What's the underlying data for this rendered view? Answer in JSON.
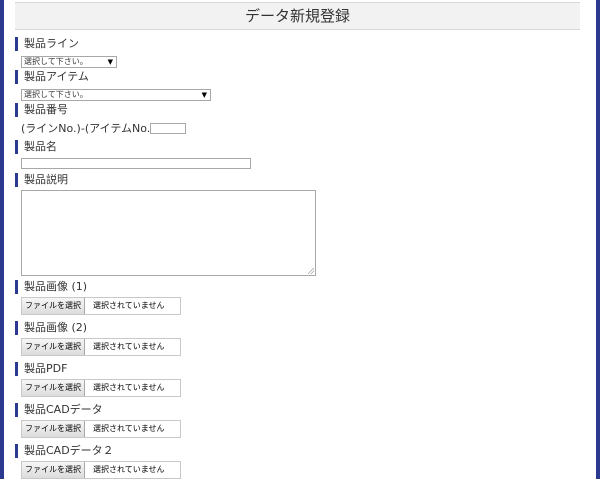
{
  "page": {
    "title": "データ新規登録"
  },
  "form": {
    "product_line": {
      "label": "製品ライン",
      "selected": "選択して下さい。"
    },
    "product_item": {
      "label": "製品アイテム",
      "selected": "選択して下さい。"
    },
    "product_number": {
      "label": "製品番号",
      "prefix": "(ラインNo.)-(アイテムNo.)-",
      "value": ""
    },
    "product_name": {
      "label": "製品名",
      "value": ""
    },
    "product_description": {
      "label": "製品説明",
      "value": ""
    },
    "image1": {
      "label": "製品画像 (1)",
      "button": "ファイルを選択",
      "status": "選択されていません"
    },
    "image2": {
      "label": "製品画像 (2)",
      "button": "ファイルを選択",
      "status": "選択されていません"
    },
    "pdf": {
      "label": "製品PDF",
      "button": "ファイルを選択",
      "status": "選択されていません"
    },
    "cad": {
      "label": "製品CADデータ",
      "button": "ファイルを選択",
      "status": "選択されていません"
    },
    "cad2": {
      "label": "製品CADデータ２",
      "button": "ファイルを選択",
      "status": "選択されていません"
    }
  },
  "colors": {
    "accent": "#2b3a8f",
    "border": "#a8a8a8",
    "title_bg": "#f2f2f2"
  }
}
